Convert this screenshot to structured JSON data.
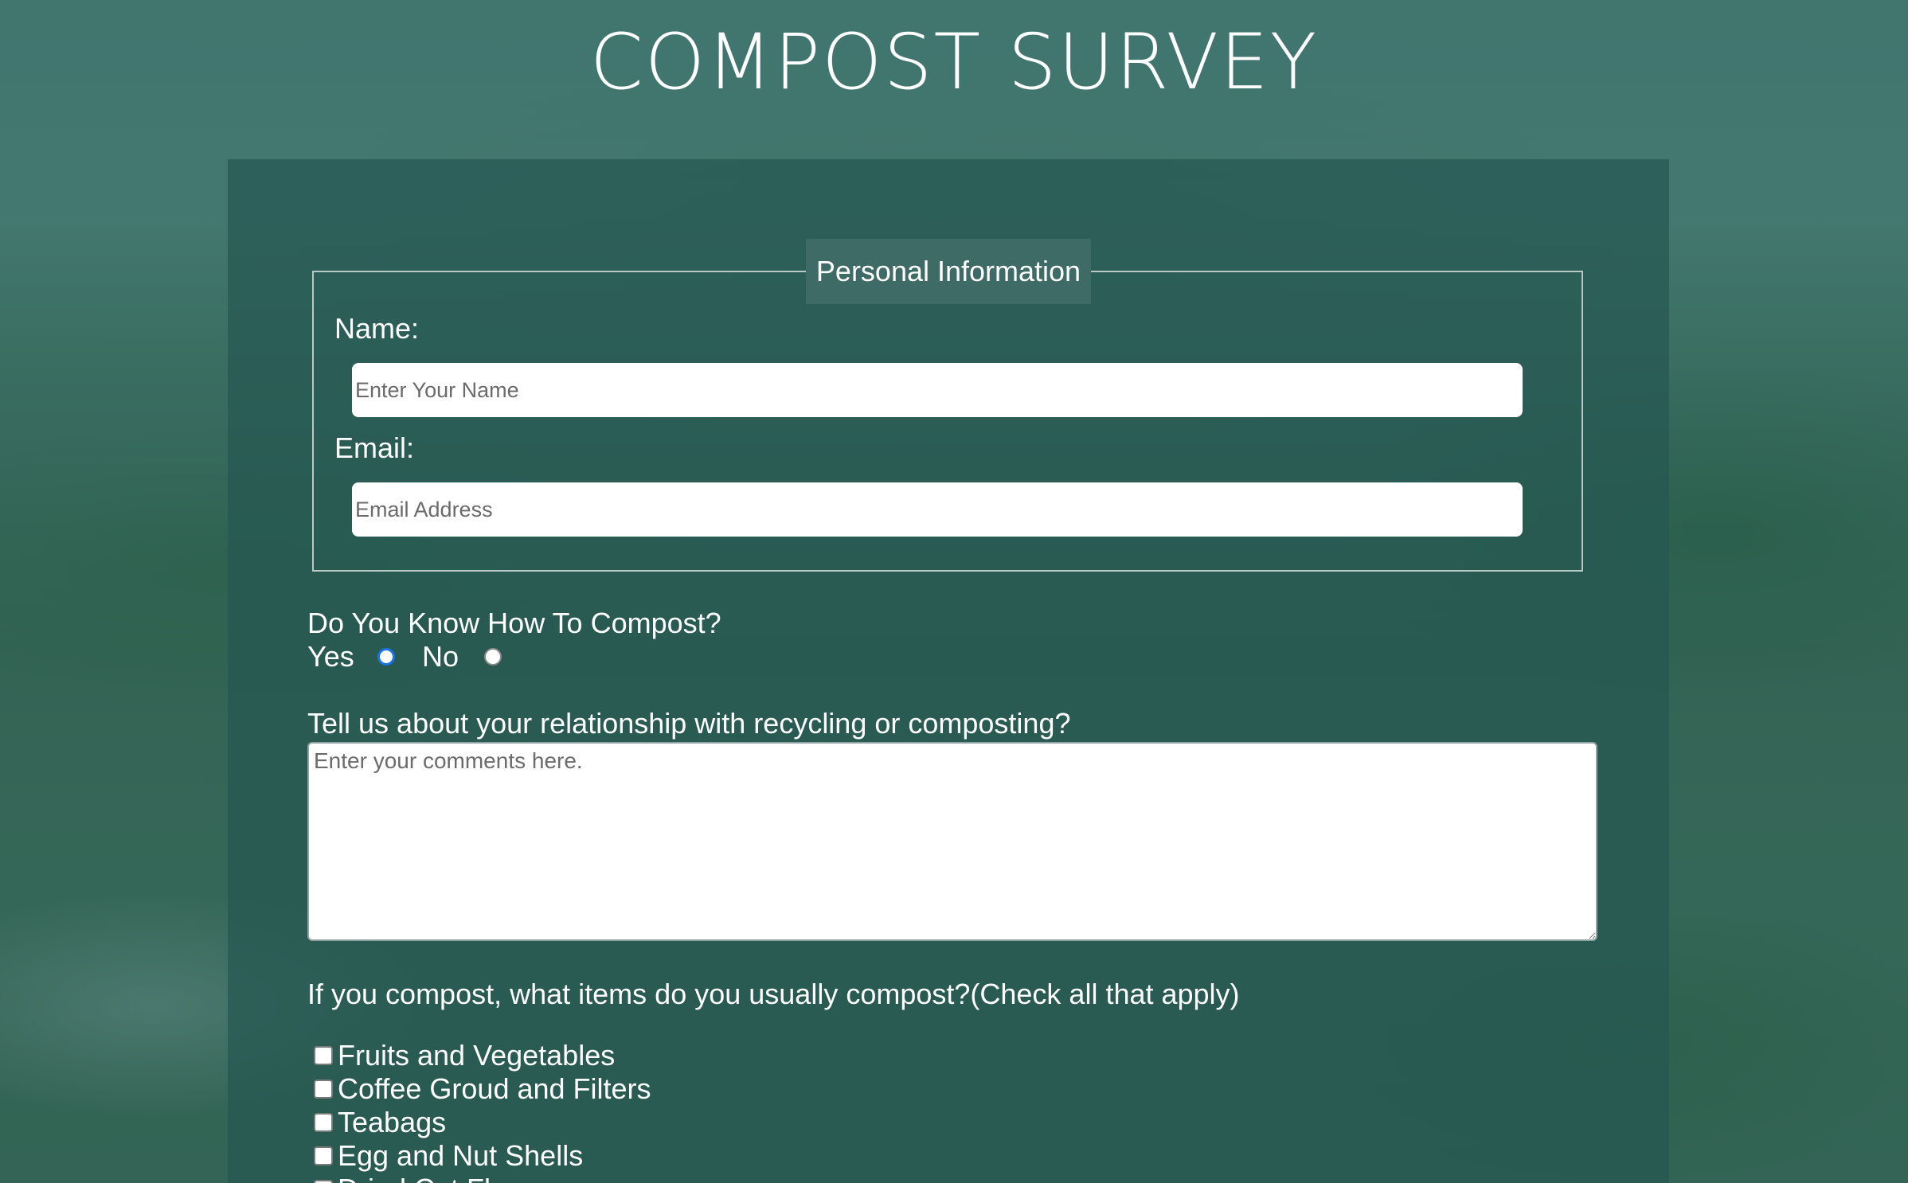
{
  "page": {
    "title": "COMPOST SURVEY"
  },
  "personal_info": {
    "legend": "Personal Information",
    "name_label": "Name:",
    "name_placeholder": "Enter Your Name",
    "email_label": "Email:",
    "email_placeholder": "Email Address"
  },
  "compost_question": {
    "label": "Do You Know How To Compost?",
    "options": [
      {
        "label": "Yes",
        "checked": true
      },
      {
        "label": "No",
        "checked": false
      }
    ]
  },
  "comments": {
    "label": "Tell us about your relationship with recycling or composting?",
    "placeholder": "Enter your comments here."
  },
  "items_question": {
    "label": "If you compost, what items do you usually compost?(Check all that apply)",
    "items": [
      {
        "label": "Fruits and Vegetables",
        "checked": false
      },
      {
        "label": "Coffee Groud and Filters",
        "checked": false
      },
      {
        "label": "Teabags",
        "checked": false
      },
      {
        "label": "Egg and Nut Shells",
        "checked": false
      },
      {
        "label": "Dried Cut Flowers",
        "checked": false
      }
    ]
  },
  "colors": {
    "accent": "#1a73e8",
    "card_background": "#26584f",
    "text": "#ffffff"
  }
}
